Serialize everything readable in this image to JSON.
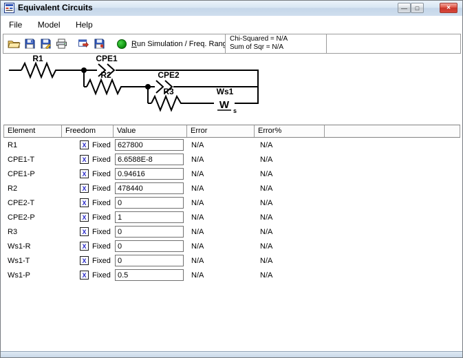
{
  "window": {
    "title": "Equivalent Circuits"
  },
  "icons": {
    "minimize": "—",
    "maximize": "□",
    "close": "×",
    "warburg_w": "W",
    "warburg_s": "s",
    "checkbox": "X"
  },
  "menu": {
    "items": [
      {
        "label": "File"
      },
      {
        "label": "Model"
      },
      {
        "label": "Help"
      }
    ]
  },
  "toolbar": {
    "icon_names": [
      "open",
      "save",
      "save-as",
      "print",
      "copy",
      "save-results"
    ],
    "run_label": "Run Simulation / Freq. Range",
    "stats": {
      "chi_squared": "Chi-Squared = N/A",
      "sum_of_sqr": "Sum of Sqr = N/A"
    }
  },
  "circuit": {
    "elements": [
      {
        "name": "R1",
        "type": "resistor"
      },
      {
        "name": "CPE1",
        "type": "constant-phase-element"
      },
      {
        "name": "R2",
        "type": "resistor"
      },
      {
        "name": "CPE2",
        "type": "constant-phase-element"
      },
      {
        "name": "R3",
        "type": "resistor"
      },
      {
        "name": "Ws1",
        "type": "warburg-short"
      }
    ]
  },
  "table": {
    "headers": [
      "Element",
      "Freedom",
      "Value",
      "Error",
      "Error%"
    ],
    "rows": [
      {
        "element": "R1",
        "freedom": "Fixed",
        "value": "627800",
        "error": "N/A",
        "error_pct": "N/A"
      },
      {
        "element": "CPE1-T",
        "freedom": "Fixed",
        "value": "6.6588E-8",
        "error": "N/A",
        "error_pct": "N/A"
      },
      {
        "element": "CPE1-P",
        "freedom": "Fixed",
        "value": "0.94616",
        "error": "N/A",
        "error_pct": "N/A"
      },
      {
        "element": "R2",
        "freedom": "Fixed",
        "value": "478440",
        "error": "N/A",
        "error_pct": "N/A"
      },
      {
        "element": "CPE2-T",
        "freedom": "Fixed",
        "value": "0",
        "error": "N/A",
        "error_pct": "N/A"
      },
      {
        "element": "CPE2-P",
        "freedom": "Fixed",
        "value": "1",
        "error": "N/A",
        "error_pct": "N/A"
      },
      {
        "element": "R3",
        "freedom": "Fixed",
        "value": "0",
        "error": "N/A",
        "error_pct": "N/A"
      },
      {
        "element": "Ws1-R",
        "freedom": "Fixed",
        "value": "0",
        "error": "N/A",
        "error_pct": "N/A"
      },
      {
        "element": "Ws1-T",
        "freedom": "Fixed",
        "value": "0",
        "error": "N/A",
        "error_pct": "N/A"
      },
      {
        "element": "Ws1-P",
        "freedom": "Fixed",
        "value": "0.5",
        "error": "N/A",
        "error_pct": "N/A"
      }
    ]
  }
}
